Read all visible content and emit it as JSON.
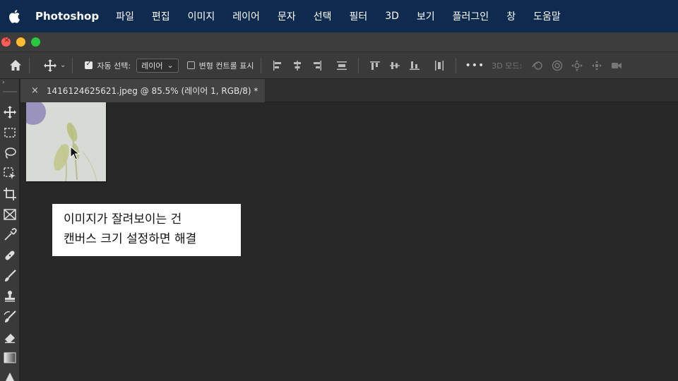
{
  "menubar": {
    "app_name": "Photoshop",
    "items": [
      "파일",
      "편집",
      "이미지",
      "레이어",
      "문자",
      "선택",
      "필터",
      "3D",
      "보기",
      "플러그인",
      "창",
      "도움말"
    ]
  },
  "options_bar": {
    "auto_select_label": "자동 선택:",
    "auto_select_checked": true,
    "auto_select_value": "레이어",
    "transform_controls_label": "변형 컨트롤 표시",
    "transform_controls_checked": false,
    "more_label": "•••",
    "mode_3d_label": "3D 모드:"
  },
  "tab": {
    "title": "1416124625621.jpeg @ 85.5% (레이어 1, RGB/8) *",
    "close": "×"
  },
  "caption": {
    "line1": "이미지가 잘려보이는 건",
    "line2": "캔버스 크기 설정하면 해결"
  },
  "icons": {
    "apple": "apple-logo-icon",
    "home": "home-icon",
    "move": "move-icon"
  },
  "colors": {
    "menubar_bg": "#0f2a4f",
    "panel_bg": "#3a3a3a",
    "canvas_bg": "#282828"
  }
}
